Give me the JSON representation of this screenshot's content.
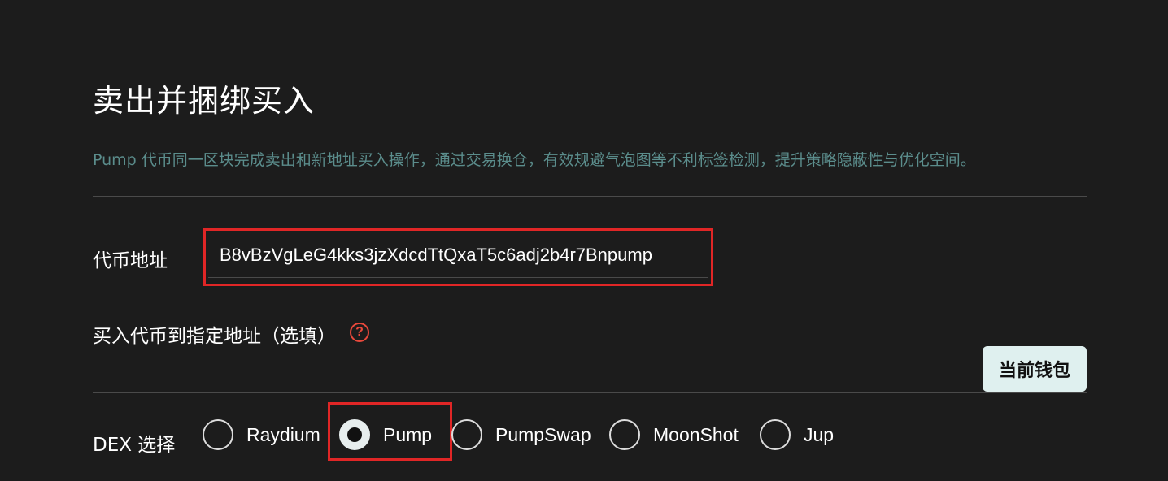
{
  "title": "卖出并捆绑买入",
  "description": "Pump 代币同一区块完成卖出和新地址买入操作，通过交易换仓，有效规避气泡图等不利标签检测，提升策略隐蔽性与优化空间。",
  "token_address": {
    "label": "代币地址",
    "value": "B8vBzVgLeG4kks3jzXdcdTtQxaT5c6adj2b4r7Bnpump"
  },
  "target_address": {
    "label": "买入代币到指定地址（选填）",
    "help_icon": "?",
    "value": "",
    "button_label": "当前钱包"
  },
  "dex": {
    "label": "DEX 选择",
    "selected": "Pump",
    "options": [
      {
        "label": "Raydium",
        "checked": false
      },
      {
        "label": "Pump",
        "checked": true
      },
      {
        "label": "PumpSwap",
        "checked": false
      },
      {
        "label": "MoonShot",
        "checked": false
      },
      {
        "label": "Jup",
        "checked": false
      }
    ]
  },
  "colors": {
    "background": "#1c1c1c",
    "description": "#5b8d8c",
    "highlight": "#e02626",
    "help_icon": "#e8483b",
    "button_bg": "#dff0ef"
  }
}
